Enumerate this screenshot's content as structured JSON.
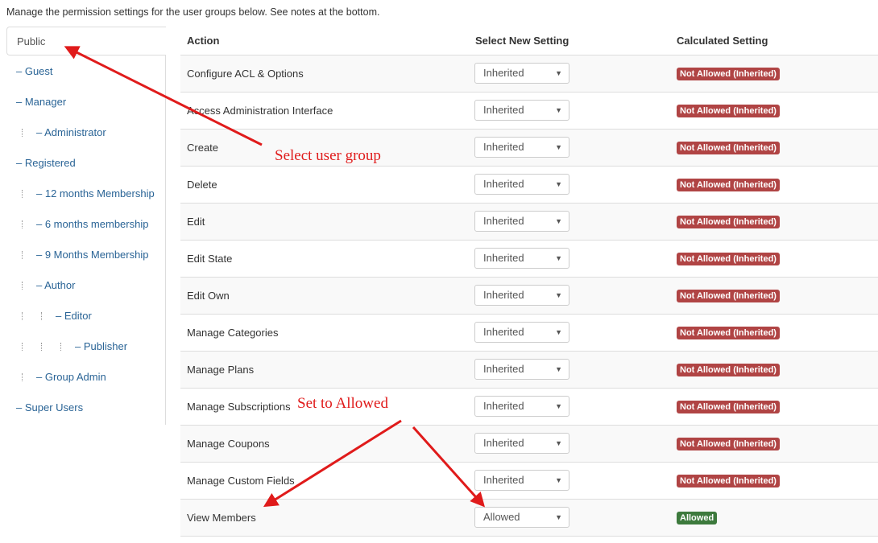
{
  "intro": "Manage the permission settings for the user groups below. See notes at the bottom.",
  "groups": [
    {
      "label": "Public",
      "depth": 0,
      "active": true
    },
    {
      "label": "– Guest",
      "depth": 0
    },
    {
      "label": "– Manager",
      "depth": 0
    },
    {
      "label": "– Administrator",
      "depth": 1
    },
    {
      "label": "– Registered",
      "depth": 0
    },
    {
      "label": "– 12 months Membership",
      "depth": 1
    },
    {
      "label": "– 6 months membership",
      "depth": 1
    },
    {
      "label": "– 9 Months Membership",
      "depth": 1
    },
    {
      "label": "– Author",
      "depth": 1
    },
    {
      "label": "– Editor",
      "depth": 2
    },
    {
      "label": "– Publisher",
      "depth": 3
    },
    {
      "label": "– Group Admin",
      "depth": 1
    },
    {
      "label": "– Super Users",
      "depth": 0
    }
  ],
  "table": {
    "headers": {
      "action": "Action",
      "select": "Select New Setting",
      "calculated": "Calculated Setting"
    },
    "rows": [
      {
        "action": "Configure ACL & Options",
        "setting": "Inherited",
        "calculated": "Not Allowed (Inherited)",
        "status": "bad"
      },
      {
        "action": "Access Administration Interface",
        "setting": "Inherited",
        "calculated": "Not Allowed (Inherited)",
        "status": "bad"
      },
      {
        "action": "Create",
        "setting": "Inherited",
        "calculated": "Not Allowed (Inherited)",
        "status": "bad"
      },
      {
        "action": "Delete",
        "setting": "Inherited",
        "calculated": "Not Allowed (Inherited)",
        "status": "bad"
      },
      {
        "action": "Edit",
        "setting": "Inherited",
        "calculated": "Not Allowed (Inherited)",
        "status": "bad"
      },
      {
        "action": "Edit State",
        "setting": "Inherited",
        "calculated": "Not Allowed (Inherited)",
        "status": "bad"
      },
      {
        "action": "Edit Own",
        "setting": "Inherited",
        "calculated": "Not Allowed (Inherited)",
        "status": "bad"
      },
      {
        "action": "Manage Categories",
        "setting": "Inherited",
        "calculated": "Not Allowed (Inherited)",
        "status": "bad"
      },
      {
        "action": "Manage Plans",
        "setting": "Inherited",
        "calculated": "Not Allowed (Inherited)",
        "status": "bad"
      },
      {
        "action": "Manage Subscriptions",
        "setting": "Inherited",
        "calculated": "Not Allowed (Inherited)",
        "status": "bad"
      },
      {
        "action": "Manage Coupons",
        "setting": "Inherited",
        "calculated": "Not Allowed (Inherited)",
        "status": "bad"
      },
      {
        "action": "Manage Custom Fields",
        "setting": "Inherited",
        "calculated": "Not Allowed (Inherited)",
        "status": "bad"
      },
      {
        "action": "View Members",
        "setting": "Allowed",
        "calculated": "Allowed",
        "status": "good"
      }
    ]
  },
  "annotations": {
    "select_group": "Select user group",
    "set_allowed": "Set to Allowed",
    "color": "#e01b1b"
  },
  "caret": "▼"
}
